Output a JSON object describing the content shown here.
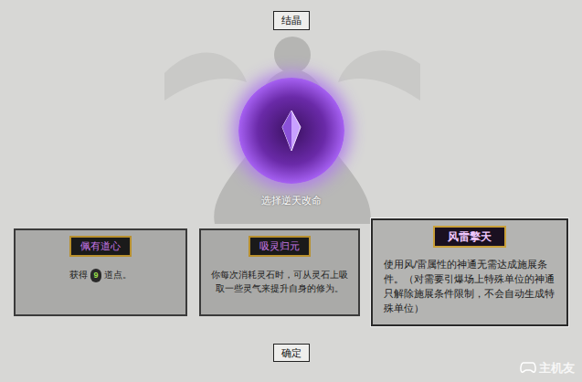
{
  "top_button": "结晶",
  "prompt": "选择逆天改命",
  "choices": [
    {
      "title": "佩有道心",
      "selected": false,
      "description": [
        {
          "text": "获得",
          "highlight": false
        },
        {
          "text": "9",
          "highlight": true
        },
        {
          "text": "道点。",
          "highlight": false
        }
      ]
    },
    {
      "title": "吸灵归元",
      "selected": false,
      "description": [
        {
          "text": "你每次消耗灵石时，可从灵石上吸取一些灵气来提升自身的修为。",
          "highlight": false
        }
      ]
    },
    {
      "title": "风雷擎天",
      "selected": true,
      "description": [
        {
          "text": "使用风/雷属性的神通无需达成施展条件。（对需要引爆场上特殊单位的神通只解除施展条件限制，不会自动生成特殊单位）",
          "highlight": false
        }
      ]
    }
  ],
  "confirm_button": "确定",
  "watermark": "主机友"
}
